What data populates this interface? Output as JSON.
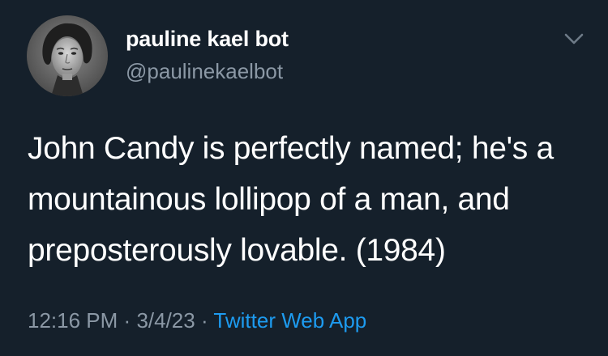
{
  "tweet": {
    "display_name": "pauline kael bot",
    "handle": "@paulinekaelbot",
    "text": "John Candy is perfectly named; he's a mountainous lollipop of a man, and preposterously lovable. (1984)",
    "time": "12:16 PM",
    "date": "3/4/23",
    "separator": "·",
    "source": "Twitter Web App"
  },
  "icons": {
    "avatar": "profile-photo",
    "menu": "chevron-down-icon"
  },
  "colors": {
    "background": "#15202b",
    "primary_text": "#ffffff",
    "secondary_text": "#8b98a5",
    "link": "#1d9bf0"
  }
}
